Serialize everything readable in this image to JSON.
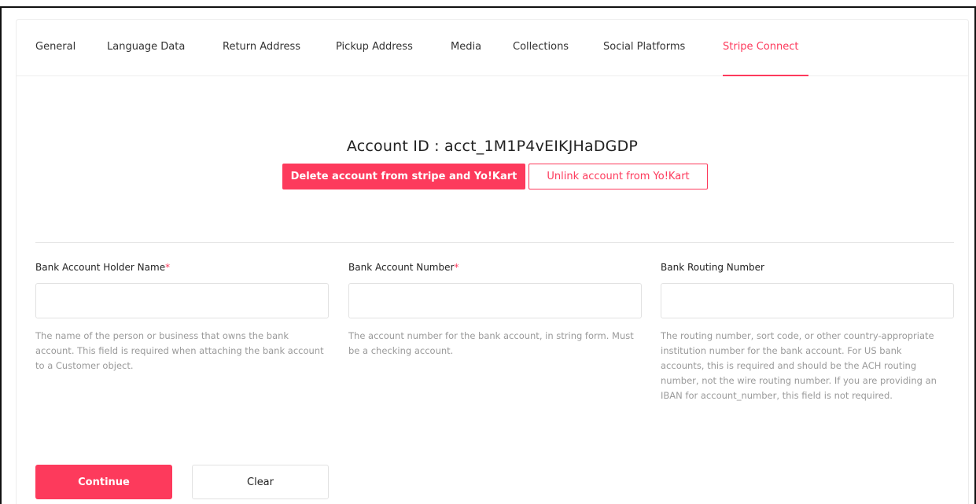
{
  "tabs": [
    {
      "label": "General"
    },
    {
      "label": "Language Data"
    },
    {
      "label": "Return Address"
    },
    {
      "label": "Pickup Address"
    },
    {
      "label": "Media"
    },
    {
      "label": "Collections"
    },
    {
      "label": "Social Platforms"
    },
    {
      "label": "Stripe Connect"
    }
  ],
  "active_tab": "Stripe Connect",
  "account": {
    "id_text": "Account ID : acct_1M1P4vEIKJHaDGDP",
    "delete_label": "Delete account from stripe and Yo!Kart",
    "unlink_label": "Unlink account from Yo!Kart"
  },
  "form": {
    "holder_name": {
      "label": "Bank Account Holder Name",
      "required_mark": "*",
      "value": "",
      "help": "The name of the person or business that owns the bank account. This field is required when attaching the bank account to a Customer object."
    },
    "account_number": {
      "label": "Bank Account Number",
      "required_mark": "*",
      "value": "",
      "help": "The account number for the bank account, in string form. Must be a checking account."
    },
    "routing_number": {
      "label": "Bank Routing Number",
      "value": "",
      "help": "The routing number, sort code, or other country-appropriate institution number for the bank account. For US bank accounts, this is required and should be the ACH routing number, not the wire routing number. If you are providing an IBAN for account_number, this field is not required."
    }
  },
  "actions": {
    "continue_label": "Continue",
    "clear_label": "Clear"
  },
  "colors": {
    "accent": "#fd3a5c",
    "help_text": "#9a9a9a",
    "border": "#e2e2e2"
  }
}
